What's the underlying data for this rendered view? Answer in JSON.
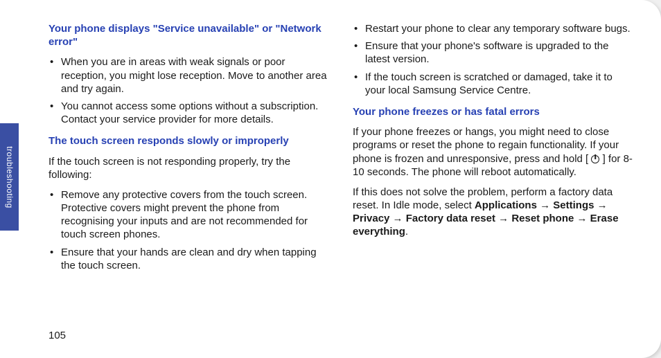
{
  "sideTab": "troubleshooting",
  "pageNumber": "105",
  "col1": {
    "h1": "Your phone displays \"Service unavailable\" or \"Network error\"",
    "b1": [
      "When you are in areas with weak signals or poor reception, you might lose reception. Move to another area and try again.",
      "You cannot access some options without a subscription. Contact your service provider for more details."
    ],
    "h2": "The touch screen responds slowly or improperly",
    "p2": "If the touch screen is not responding properly, try the following:",
    "b2": [
      "Remove any protective covers from the touch screen. Protective covers might prevent the phone from recognising your inputs and are not recommended for touch screen phones.",
      "Ensure that your hands are clean and dry when tapping the touch screen."
    ]
  },
  "col2": {
    "b1": [
      "Restart your phone to clear any temporary software bugs.",
      "Ensure that your phone's software is upgraded to the latest version.",
      "If the touch screen is scratched or damaged, take it to your local Samsung Service Centre."
    ],
    "h1": "Your phone freezes or has fatal errors",
    "p1a": "If your phone freezes or hangs, you might need to close programs or reset the phone to regain functionality. If your phone is frozen and unresponsive, press and hold [ ",
    "p1b": " ] for 8-10 seconds. The phone will reboot automatically.",
    "p2a": "If this does not solve the problem, perform a factory data reset. In Idle mode, select ",
    "p2b": "Applications",
    "arrow": " → ",
    "p2c": "Settings",
    "p2d": "Privacy",
    "p2e": "Factory data reset",
    "p2f": "Reset phone",
    "p2g": "Erase everything",
    "period": "."
  }
}
